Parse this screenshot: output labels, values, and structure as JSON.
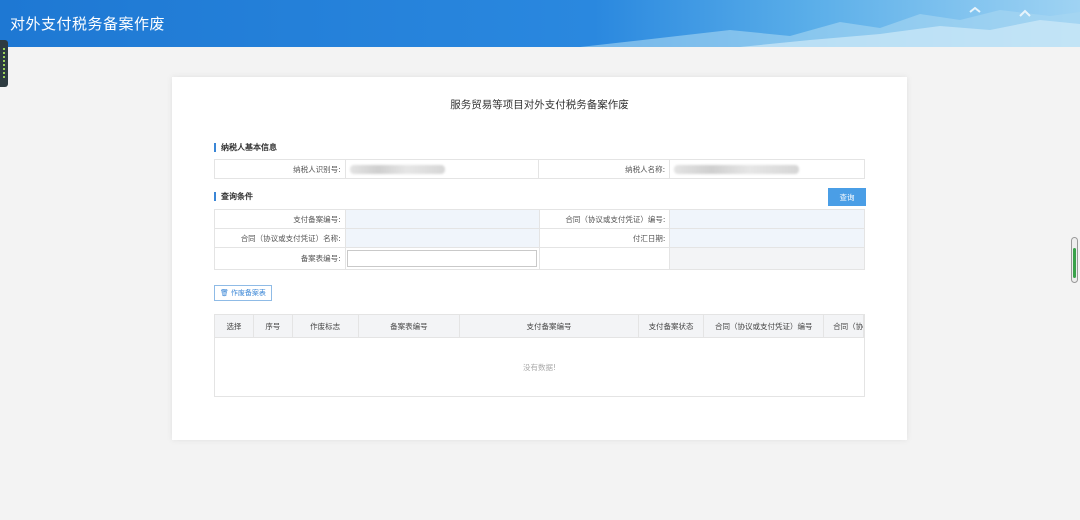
{
  "header": {
    "title": "对外支付税务备案作废"
  },
  "page": {
    "title": "服务贸易等项目对外支付税务备案作废"
  },
  "taxpayer": {
    "section_label": "纳税人基本信息",
    "id_label": "纳税人识别号:",
    "name_label": "纳税人名称:"
  },
  "query": {
    "section_label": "查询条件",
    "button_label": "查询",
    "pay_record_no_label": "支付备案编号:",
    "contract_no_label": "合同（协议或支付凭证）编号:",
    "contract_name_label": "合同（协议或支付凭证）名称:",
    "remit_date_label": "付汇日期:",
    "record_form_no_label": "备案表编号:"
  },
  "actions": {
    "void_label": "作废备案表"
  },
  "table": {
    "columns": [
      "选择",
      "序号",
      "作废标志",
      "备案表编号",
      "支付备案编号",
      "支付备案状态",
      "合同（协议或支付凭证）编号",
      "合同（协"
    ],
    "empty_text": "没有数据!"
  }
}
